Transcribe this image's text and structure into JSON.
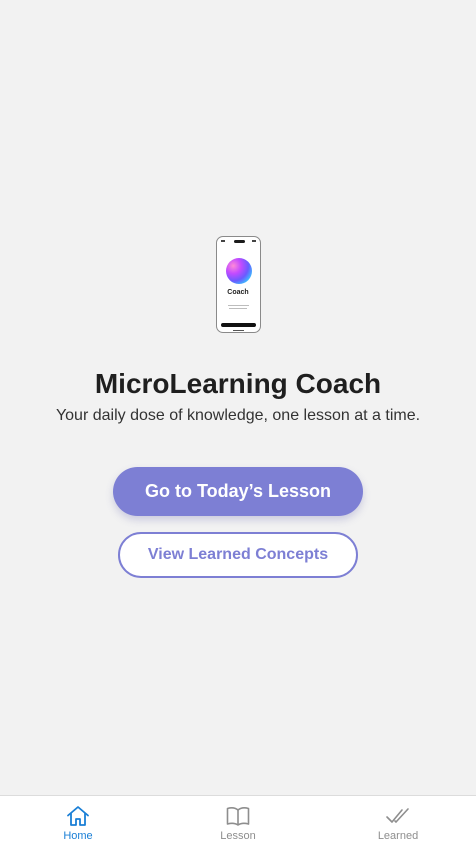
{
  "illustration": {
    "screen_title": "Coach"
  },
  "hero": {
    "title": "MicroLearning Coach",
    "subtitle": "Your daily dose of knowledge, one lesson at a time."
  },
  "actions": {
    "primary_label": "Go to Today’s Lesson",
    "secondary_label": "View Learned Concepts"
  },
  "tabbar": {
    "active": "Home",
    "tabs": [
      {
        "label": "Home",
        "icon": "home-icon"
      },
      {
        "label": "Lesson",
        "icon": "book-icon"
      },
      {
        "label": "Learned",
        "icon": "double-check-icon"
      }
    ]
  },
  "colors": {
    "background": "#f2f2f2",
    "accent": "#7d7fd4",
    "active_tab": "#1a7fd6",
    "inactive_tab": "#8e8e8e"
  }
}
